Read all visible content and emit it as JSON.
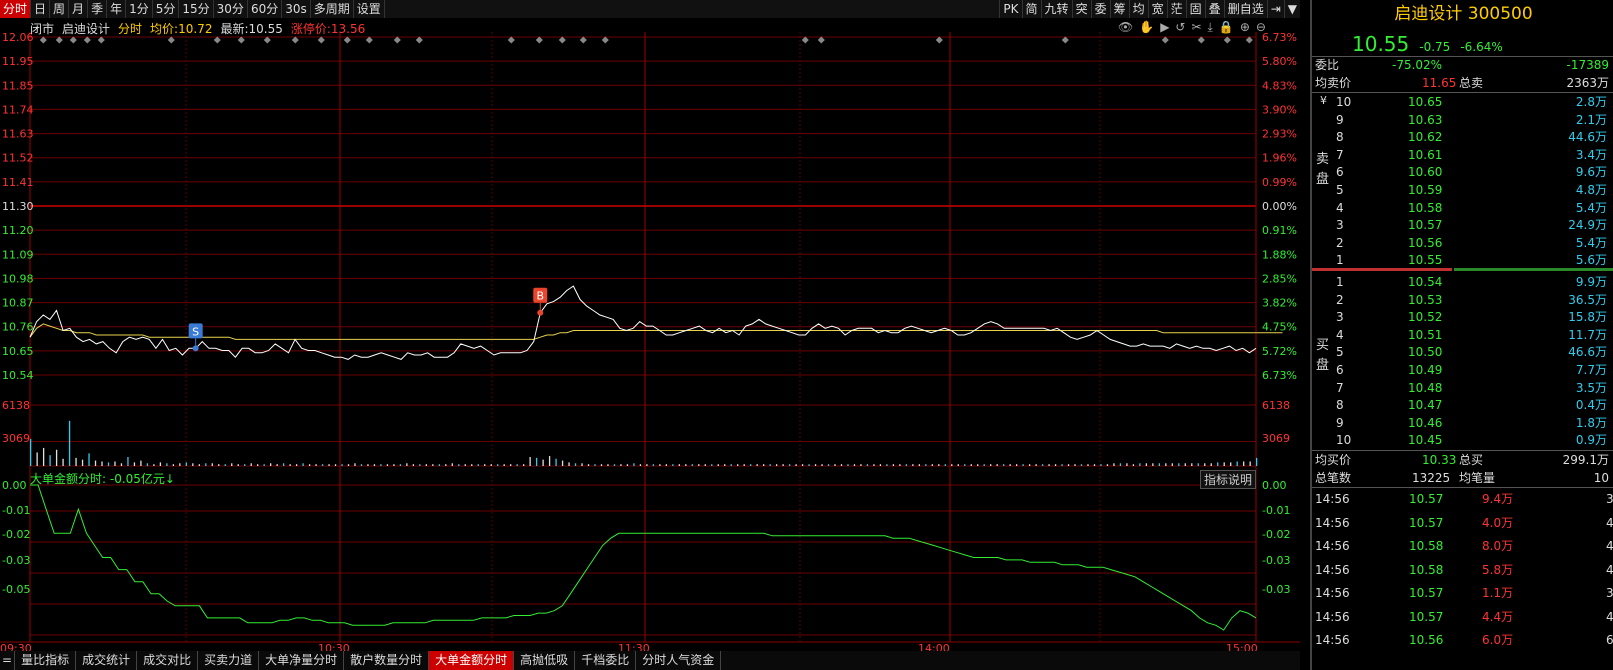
{
  "toolbar": {
    "items": [
      "分时",
      "日",
      "周",
      "月",
      "季",
      "年",
      "1分",
      "5分",
      "15分",
      "30分",
      "60分",
      "30s",
      "多周期",
      "设置"
    ],
    "active_index": 0,
    "right_items": [
      "PK",
      "简",
      "九转",
      "突",
      "委",
      "筹",
      "均",
      "宽",
      "茫",
      "固",
      "叠",
      "删自选",
      "⇥",
      "▼"
    ]
  },
  "info": {
    "status": "闭市",
    "name": "启迪设计",
    "kind": "分时",
    "avg_label": "均价:",
    "avg_value": "10.72",
    "last_label": "最新:",
    "last_value": "10.55",
    "limit_label": "涨停价:",
    "limit_value": "13.56"
  },
  "chart_icons": [
    "eye-icon",
    "hand-icon",
    "play-icon",
    "replay-icon",
    "scissors-icon",
    "download-icon",
    "lock-icon",
    "zoom-in-icon",
    "zoom-out-icon"
  ],
  "axes": {
    "left_price": [
      "12.06",
      "11.95",
      "11.85",
      "11.74",
      "11.63",
      "11.52",
      "11.41",
      "11.30",
      "11.20",
      "11.09",
      "10.98",
      "10.87",
      "10.76",
      "10.65",
      "10.54"
    ],
    "right_pct": [
      "6.73%",
      "5.80%",
      "4.83%",
      "3.90%",
      "2.93%",
      "1.96%",
      "0.99%",
      "0.00%",
      "0.91%",
      "1.88%",
      "2.85%",
      "3.82%",
      "4.75%",
      "5.72%",
      "6.73%"
    ],
    "vol_left": [
      "6138",
      "3069"
    ],
    "vol_right": [
      "6138",
      "3069"
    ],
    "lower_left": [
      "0.00",
      "-0.01",
      "-0.02",
      "-0.03",
      "-0.05",
      "-0.05"
    ],
    "lower_right": [
      "0.00",
      "-0.01",
      "-0.02",
      "-0.03",
      "-0.03",
      "-0.05"
    ],
    "time": [
      "09:30",
      "10:30",
      "11:30",
      "14:00",
      "15:00"
    ]
  },
  "colors": {
    "price_line": "#ffffff",
    "avg_line": "#e8d34a",
    "vol_bar": "#e0e0e0",
    "vol_bar_alt": "#33ccee",
    "lower_line": "#33ee33",
    "grid": "#8b0000",
    "up": "#ff3333",
    "down": "#33ee33",
    "accent": "#cc0000"
  },
  "markers": [
    {
      "label": "S",
      "color": "#3a7bd5"
    },
    {
      "label": "B",
      "color": "#e8452c"
    }
  ],
  "chart_data": {
    "type": "line",
    "price_series": [
      10.71,
      10.78,
      10.81,
      10.79,
      10.83,
      10.74,
      10.75,
      10.71,
      10.69,
      10.7,
      10.68,
      10.69,
      10.66,
      10.64,
      10.69,
      10.71,
      10.7,
      10.71,
      10.7,
      10.66,
      10.7,
      10.65,
      10.66,
      10.63,
      10.66,
      10.66,
      10.69,
      10.66,
      10.66,
      10.65,
      10.65,
      10.62,
      10.66,
      10.66,
      10.64,
      10.64,
      10.65,
      10.68,
      10.66,
      10.64,
      10.7,
      10.66,
      10.65,
      10.65,
      10.64,
      10.63,
      10.62,
      10.62,
      10.61,
      10.63,
      10.62,
      10.62,
      10.63,
      10.64,
      10.63,
      10.62,
      10.61,
      10.64,
      10.63,
      10.63,
      10.64,
      10.62,
      10.62,
      10.62,
      10.64,
      10.68,
      10.67,
      10.66,
      10.67,
      10.65,
      10.63,
      10.64,
      10.64,
      10.64,
      10.64,
      10.65,
      10.69,
      10.82,
      10.86,
      10.87,
      10.89,
      10.92,
      10.94,
      10.88,
      10.85,
      10.83,
      10.81,
      10.8,
      10.79,
      10.75,
      10.74,
      10.75,
      10.78,
      10.76,
      10.76,
      10.74,
      10.72,
      10.72,
      10.73,
      10.74,
      10.75,
      10.76,
      10.74,
      10.73,
      10.75,
      10.73,
      10.74,
      10.72,
      10.76,
      10.77,
      10.79,
      10.77,
      10.76,
      10.75,
      10.74,
      10.73,
      10.72,
      10.72,
      10.75,
      10.77,
      10.75,
      10.76,
      10.75,
      10.72,
      10.74,
      10.75,
      10.75,
      10.75,
      10.73,
      10.74,
      10.73,
      10.73,
      10.75,
      10.76,
      10.75,
      10.74,
      10.73,
      10.74,
      10.75,
      10.74,
      10.72,
      10.72,
      10.73,
      10.75,
      10.77,
      10.78,
      10.77,
      10.75,
      10.75,
      10.75,
      10.75,
      10.75,
      10.75,
      10.75,
      10.74,
      10.75,
      10.73,
      10.71,
      10.7,
      10.71,
      10.72,
      10.74,
      10.72,
      10.7,
      10.69,
      10.68,
      10.67,
      10.67,
      10.68,
      10.67,
      10.67,
      10.67,
      10.66,
      10.68,
      10.67,
      10.66,
      10.67,
      10.66,
      10.66,
      10.65,
      10.66,
      10.67,
      10.65,
      10.66,
      10.64,
      10.66
    ],
    "avg_series": [
      10.71,
      10.75,
      10.77,
      10.76,
      10.75,
      10.74,
      10.74,
      10.73,
      10.73,
      10.73,
      10.72,
      10.72,
      10.72,
      10.72,
      10.72,
      10.72,
      10.72,
      10.72,
      10.71,
      10.71,
      10.71,
      10.71,
      10.71,
      10.71,
      10.71,
      10.71,
      10.71,
      10.71,
      10.71,
      10.71,
      10.71,
      10.7,
      10.7,
      10.7,
      10.7,
      10.7,
      10.7,
      10.7,
      10.7,
      10.7,
      10.7,
      10.7,
      10.7,
      10.7,
      10.7,
      10.7,
      10.7,
      10.7,
      10.7,
      10.7,
      10.7,
      10.7,
      10.7,
      10.7,
      10.7,
      10.7,
      10.7,
      10.7,
      10.7,
      10.7,
      10.7,
      10.7,
      10.7,
      10.7,
      10.7,
      10.7,
      10.7,
      10.7,
      10.7,
      10.7,
      10.7,
      10.7,
      10.7,
      10.7,
      10.7,
      10.7,
      10.7,
      10.71,
      10.72,
      10.72,
      10.73,
      10.73,
      10.74,
      10.74,
      10.74,
      10.74,
      10.74,
      10.74,
      10.74,
      10.74,
      10.74,
      10.74,
      10.74,
      10.74,
      10.74,
      10.74,
      10.74,
      10.74,
      10.74,
      10.74,
      10.74,
      10.74,
      10.74,
      10.74,
      10.74,
      10.74,
      10.74,
      10.74,
      10.74,
      10.74,
      10.74,
      10.74,
      10.74,
      10.74,
      10.74,
      10.74,
      10.74,
      10.74,
      10.74,
      10.74,
      10.74,
      10.74,
      10.74,
      10.74,
      10.74,
      10.74,
      10.74,
      10.74,
      10.74,
      10.74,
      10.74,
      10.74,
      10.74,
      10.74,
      10.74,
      10.74,
      10.74,
      10.74,
      10.74,
      10.74,
      10.74,
      10.74,
      10.74,
      10.74,
      10.74,
      10.74,
      10.74,
      10.74,
      10.74,
      10.74,
      10.74,
      10.74,
      10.74,
      10.74,
      10.74,
      10.74,
      10.74,
      10.74,
      10.74,
      10.74,
      10.74,
      10.74,
      10.74,
      10.74,
      10.74,
      10.74,
      10.74,
      10.74,
      10.74,
      10.74,
      10.74,
      10.73,
      10.73,
      10.73,
      10.73,
      10.73,
      10.73,
      10.73,
      10.73,
      10.73,
      10.73,
      10.73,
      10.73,
      10.73,
      10.73,
      10.73,
      10.73,
      10.73,
      10.73,
      10.73
    ],
    "volume": [
      3000,
      1500,
      2000,
      1200,
      1800,
      800,
      5000,
      900,
      700,
      1400,
      600,
      500,
      400,
      500,
      300,
      1000,
      400,
      600,
      300,
      200,
      400,
      300,
      200,
      300,
      400,
      300,
      200,
      300,
      300,
      200,
      200,
      300,
      200,
      200,
      300,
      200,
      200,
      300,
      200,
      300,
      200,
      200,
      300,
      200,
      200,
      200,
      200,
      200,
      200,
      200,
      300,
      200,
      200,
      200,
      200,
      200,
      200,
      200,
      300,
      200,
      200,
      200,
      200,
      200,
      200,
      300,
      200,
      200,
      200,
      200,
      200,
      200,
      200,
      200,
      200,
      200,
      200,
      1000,
      900,
      700,
      1100,
      800,
      600,
      400,
      300,
      300,
      200,
      200,
      200,
      200,
      200,
      200,
      200,
      300,
      200,
      200,
      200,
      200,
      200,
      200,
      200,
      200,
      200,
      200,
      200,
      200,
      200,
      200,
      200,
      200,
      200,
      200,
      200,
      200,
      200,
      200,
      200,
      200,
      200,
      200,
      200,
      200,
      200,
      200,
      200,
      200,
      200,
      200,
      200,
      200,
      200,
      200,
      200,
      200,
      200,
      200,
      200,
      200,
      200,
      200,
      200,
      200,
      200,
      200,
      200,
      200,
      200,
      200,
      200,
      200,
      200,
      200,
      200,
      200,
      200,
      200,
      200,
      200,
      200,
      200,
      200,
      200,
      200,
      200,
      200,
      200,
      200,
      300,
      300,
      300,
      200,
      300,
      300,
      300,
      300,
      300,
      300,
      300,
      300,
      300,
      300,
      300,
      300,
      400,
      400,
      400,
      500,
      500,
      500,
      900
    ],
    "big_order_series": [
      0.0,
      0.0,
      -0.01,
      -0.02,
      -0.02,
      -0.02,
      -0.01,
      -0.02,
      -0.025,
      -0.03,
      -0.03,
      -0.035,
      -0.035,
      -0.04,
      -0.04,
      -0.045,
      -0.045,
      -0.048,
      -0.05,
      -0.05,
      -0.05,
      -0.05,
      -0.055,
      -0.055,
      -0.055,
      -0.055,
      -0.055,
      -0.057,
      -0.057,
      -0.057,
      -0.057,
      -0.056,
      -0.056,
      -0.055,
      -0.055,
      -0.056,
      -0.056,
      -0.057,
      -0.057,
      -0.057,
      -0.058,
      -0.058,
      -0.058,
      -0.058,
      -0.058,
      -0.057,
      -0.057,
      -0.057,
      -0.057,
      -0.057,
      -0.056,
      -0.056,
      -0.056,
      -0.056,
      -0.056,
      -0.056,
      -0.055,
      -0.055,
      -0.055,
      -0.055,
      -0.054,
      -0.054,
      -0.054,
      -0.053,
      -0.053,
      -0.052,
      -0.05,
      -0.045,
      -0.04,
      -0.035,
      -0.03,
      -0.025,
      -0.022,
      -0.02,
      -0.02,
      -0.02,
      -0.02,
      -0.02,
      -0.02,
      -0.02,
      -0.02,
      -0.02,
      -0.02,
      -0.02,
      -0.02,
      -0.02,
      -0.02,
      -0.02,
      -0.02,
      -0.02,
      -0.02,
      -0.02,
      -0.021,
      -0.021,
      -0.021,
      -0.021,
      -0.021,
      -0.021,
      -0.021,
      -0.021,
      -0.021,
      -0.021,
      -0.021,
      -0.021,
      -0.021,
      -0.021,
      -0.021,
      -0.022,
      -0.022,
      -0.022,
      -0.023,
      -0.024,
      -0.025,
      -0.026,
      -0.027,
      -0.028,
      -0.029,
      -0.03,
      -0.03,
      -0.03,
      -0.03,
      -0.031,
      -0.031,
      -0.031,
      -0.032,
      -0.032,
      -0.032,
      -0.032,
      -0.033,
      -0.033,
      -0.033,
      -0.034,
      -0.034,
      -0.034,
      -0.035,
      -0.036,
      -0.037,
      -0.038,
      -0.04,
      -0.042,
      -0.044,
      -0.046,
      -0.048,
      -0.05,
      -0.052,
      -0.055,
      -0.057,
      -0.058,
      -0.06,
      -0.055,
      -0.052,
      -0.053,
      -0.055
    ],
    "x_range": [
      "09:30",
      "15:00"
    ],
    "price_ylim": [
      10.54,
      12.06
    ],
    "lower_ylim": [
      -0.06,
      0.0
    ]
  },
  "lower_title": "大单金额分时: -0.05亿元↓",
  "indicator_btn": "指标说明",
  "bottom_tabs": [
    "量比指标",
    "成交统计",
    "成交对比",
    "买卖力道",
    "大单净量分时",
    "散户数量分时",
    "大单金额分时",
    "高抛低吸",
    "千档委比",
    "分时人气资金"
  ],
  "bottom_active": 6,
  "bottom_leading": "=",
  "panel": {
    "title": "启迪设计 300500",
    "price": "10.55",
    "chg": "-0.75",
    "pct": "-6.64%",
    "weibi_label": "委比",
    "weibi_value": "-75.02%",
    "weicha_value": "-17389",
    "avg_sell_label": "均卖价",
    "avg_sell_value": "11.65",
    "total_sell_label": "总卖",
    "total_sell_value": "2363万",
    "sell_side_label": "卖盘",
    "buy_side_label": "买盘",
    "yen": "¥",
    "sells": [
      {
        "idx": "10",
        "price": "10.65",
        "vol": "2.8万"
      },
      {
        "idx": "9",
        "price": "10.63",
        "vol": "2.1万"
      },
      {
        "idx": "8",
        "price": "10.62",
        "vol": "44.6万"
      },
      {
        "idx": "7",
        "price": "10.61",
        "vol": "3.4万"
      },
      {
        "idx": "6",
        "price": "10.60",
        "vol": "9.6万"
      },
      {
        "idx": "5",
        "price": "10.59",
        "vol": "4.8万"
      },
      {
        "idx": "4",
        "price": "10.58",
        "vol": "5.4万"
      },
      {
        "idx": "3",
        "price": "10.57",
        "vol": "24.9万"
      },
      {
        "idx": "2",
        "price": "10.56",
        "vol": "5.4万"
      },
      {
        "idx": "1",
        "price": "10.55",
        "vol": "5.6万"
      }
    ],
    "buys": [
      {
        "idx": "1",
        "price": "10.54",
        "vol": "9.9万"
      },
      {
        "idx": "2",
        "price": "10.53",
        "vol": "36.5万"
      },
      {
        "idx": "3",
        "price": "10.52",
        "vol": "15.8万"
      },
      {
        "idx": "4",
        "price": "10.51",
        "vol": "11.7万"
      },
      {
        "idx": "5",
        "price": "10.50",
        "vol": "46.6万"
      },
      {
        "idx": "6",
        "price": "10.49",
        "vol": "7.7万"
      },
      {
        "idx": "7",
        "price": "10.48",
        "vol": "3.5万"
      },
      {
        "idx": "8",
        "price": "10.47",
        "vol": "0.4万"
      },
      {
        "idx": "9",
        "price": "10.46",
        "vol": "1.8万"
      },
      {
        "idx": "10",
        "price": "10.45",
        "vol": "0.9万"
      }
    ],
    "avg_buy_label": "均买价",
    "avg_buy_value": "10.33",
    "total_buy_label": "总买",
    "total_buy_value": "299.1万",
    "total_trades_label": "总笔数",
    "total_trades_value": "13225",
    "avg_vol_label": "均笔量",
    "avg_vol_value": "10",
    "ticks": [
      {
        "time": "14:56",
        "price": "10.57",
        "vol": "9.4万",
        "cnt": "3"
      },
      {
        "time": "14:56",
        "price": "10.57",
        "vol": "4.0万",
        "cnt": "4"
      },
      {
        "time": "14:56",
        "price": "10.58",
        "vol": "8.0万",
        "cnt": "4"
      },
      {
        "time": "14:56",
        "price": "10.58",
        "vol": "5.8万",
        "cnt": "4"
      },
      {
        "time": "14:56",
        "price": "10.57",
        "vol": "1.1万",
        "cnt": "3"
      },
      {
        "time": "14:56",
        "price": "10.57",
        "vol": "4.4万",
        "cnt": "4"
      },
      {
        "time": "14:56",
        "price": "10.56",
        "vol": "6.0万",
        "cnt": "6"
      }
    ]
  }
}
